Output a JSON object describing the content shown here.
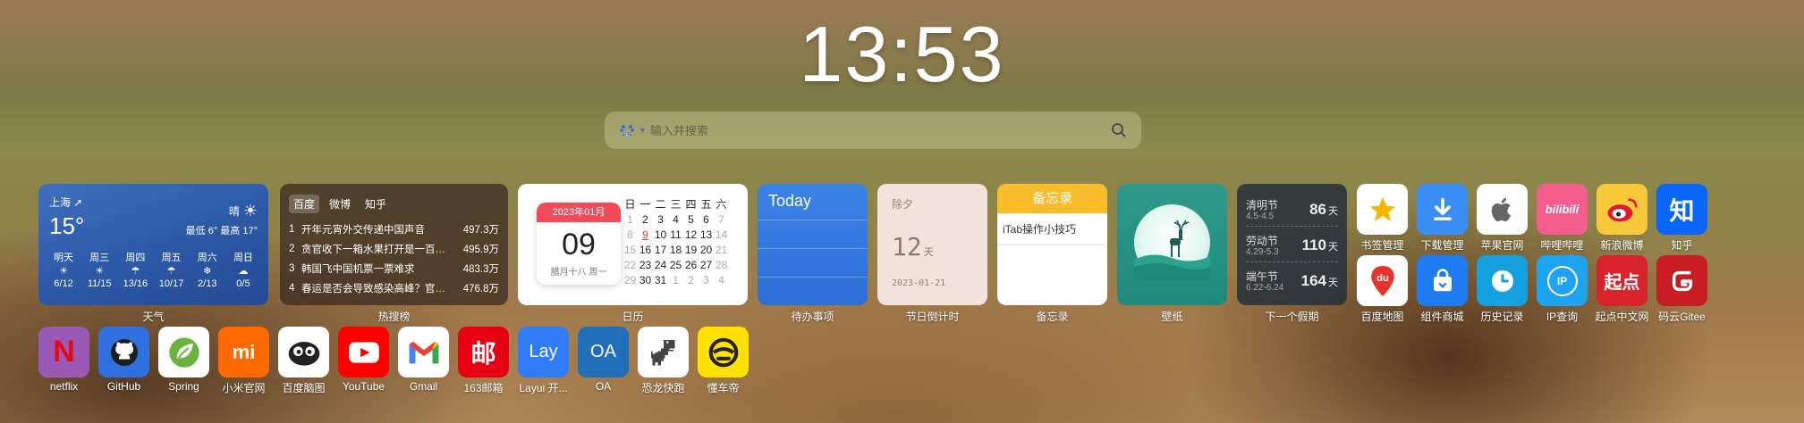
{
  "clock": "13:53",
  "search": {
    "placeholder": "输入并搜索",
    "engine_icon": "baidu-icon"
  },
  "weather": {
    "city": "上海",
    "temp": "15°",
    "condition": "晴",
    "range": "最低 6° 最高 17°",
    "days": [
      {
        "name": "明天",
        "date": "6/12",
        "icon": "sun-icon"
      },
      {
        "name": "周三",
        "date": "11/15",
        "icon": "sun-icon"
      },
      {
        "name": "周四",
        "date": "13/16",
        "icon": "rain-icon"
      },
      {
        "name": "周五",
        "date": "10/17",
        "icon": "rain-icon"
      },
      {
        "name": "周六",
        "date": "2/13",
        "icon": "snow-icon"
      },
      {
        "name": "周日",
        "date": "0/5",
        "icon": "cloud-icon"
      }
    ],
    "caption": "天气"
  },
  "hot": {
    "tabs": [
      "百度",
      "微博",
      "知乎"
    ],
    "items": [
      {
        "n": "1",
        "title": "开年元宵外交传递中国声音",
        "value": "497.3万"
      },
      {
        "n": "2",
        "title": "贪官收下一箱水果打开是一百万现金",
        "value": "495.9万"
      },
      {
        "n": "3",
        "title": "韩国飞中国机票一票难求",
        "value": "483.3万"
      },
      {
        "n": "4",
        "title": "春运是否会导致感染高峰？官方回应",
        "value": "476.8万"
      }
    ],
    "caption": "热搜榜"
  },
  "calendar": {
    "month": "2023年01月",
    "day": "09",
    "lunar": "腊月十八 周一",
    "weekdays": [
      "日",
      "一",
      "二",
      "三",
      "四",
      "五",
      "六"
    ],
    "rows": [
      [
        "1",
        "2",
        "3",
        "4",
        "5",
        "6",
        "7"
      ],
      [
        "8",
        "9",
        "10",
        "11",
        "12",
        "13",
        "14"
      ],
      [
        "15",
        "16",
        "17",
        "18",
        "19",
        "20",
        "21"
      ],
      [
        "22",
        "23",
        "24",
        "25",
        "26",
        "27",
        "28"
      ],
      [
        "29",
        "30",
        "31",
        "1",
        "2",
        "3",
        "4"
      ]
    ],
    "caption": "日历"
  },
  "todo": {
    "title": "Today",
    "caption": "待办事项"
  },
  "countdown": {
    "label": "除夕",
    "num": "12",
    "unit": "天",
    "date": "2023-01-21",
    "caption": "节日倒计时"
  },
  "memo": {
    "title": "备忘录",
    "note": "iTab操作小技巧",
    "caption": "备忘录"
  },
  "wallpaper": {
    "caption": "壁纸"
  },
  "holiday": {
    "items": [
      {
        "name": "清明节",
        "range": "4.5-4.5",
        "days": "86",
        "unit": "天"
      },
      {
        "name": "劳动节",
        "range": "4.29-5.3",
        "days": "110",
        "unit": "天"
      },
      {
        "name": "端午节",
        "range": "6.22-6.24",
        "days": "164",
        "unit": "天"
      }
    ],
    "caption": "下一个假期"
  },
  "apps_row1": [
    {
      "label": "书签管理",
      "icon": "star-icon",
      "color": "#ffffff"
    },
    {
      "label": "下载管理",
      "icon": "download-icon",
      "color": "#3a8df5"
    },
    {
      "label": "苹果官网",
      "icon": "apple-icon",
      "color": "#ffffff"
    },
    {
      "label": "哔哩哔哩",
      "icon": "bilibili-icon",
      "color": "#f25d8e"
    },
    {
      "label": "新浪微博",
      "icon": "weibo-icon",
      "color": "#f7c93a"
    },
    {
      "label": "知乎",
      "icon": "zhihu-icon",
      "color": "#0a66f6"
    }
  ],
  "apps_row2": [
    {
      "label": "百度地图",
      "icon": "baidu-map-icon",
      "color": "#ffffff"
    },
    {
      "label": "组件商城",
      "icon": "bag-icon",
      "color": "#1e7cf2"
    },
    {
      "label": "历史记录",
      "icon": "clock-icon",
      "color": "#15a0e0"
    },
    {
      "label": "IP查询",
      "icon": "ip-icon",
      "color": "#1ea3f0"
    },
    {
      "label": "起点中文网",
      "icon": "qidian-icon",
      "color": "#d8232a"
    },
    {
      "label": "码云Gitee",
      "icon": "gitee-icon",
      "color": "#c71d23"
    }
  ],
  "apps_bottom": [
    {
      "label": "netflix",
      "icon": "netflix-icon",
      "color": "#9b59b6"
    },
    {
      "label": "GitHub",
      "icon": "github-icon",
      "color": "#2f6fe0"
    },
    {
      "label": "Spring",
      "icon": "spring-icon",
      "color": "#ffffff"
    },
    {
      "label": "小米官网",
      "icon": "xiaomi-icon",
      "color": "#ff6900"
    },
    {
      "label": "百度脑图",
      "icon": "mindmap-icon",
      "color": "#ffffff"
    },
    {
      "label": "YouTube",
      "icon": "youtube-icon",
      "color": "#ff0000"
    },
    {
      "label": "Gmail",
      "icon": "gmail-icon",
      "color": "#ffffff"
    },
    {
      "label": "163邮箱",
      "icon": "mail163-icon",
      "color": "#e60012"
    },
    {
      "label": "Layui 开...",
      "icon": "layui-icon",
      "color": "#2f7cf6"
    },
    {
      "label": "OA",
      "icon": "oa-icon",
      "color": "#1f6fb8"
    },
    {
      "label": "恐龙快跑",
      "icon": "dino-icon",
      "color": "#ffffff"
    },
    {
      "label": "懂车帝",
      "icon": "dongchedi-icon",
      "color": "#ffe000"
    }
  ],
  "glyphs": {
    "layui": "Lay",
    "oa": "OA",
    "mail163": "邮",
    "qidian": "起点",
    "zhihu": "知",
    "ip": "IP",
    "xiaomi": "mi",
    "netflix": "N",
    "bilibili": "bilibili",
    "baidu_map": "du"
  }
}
